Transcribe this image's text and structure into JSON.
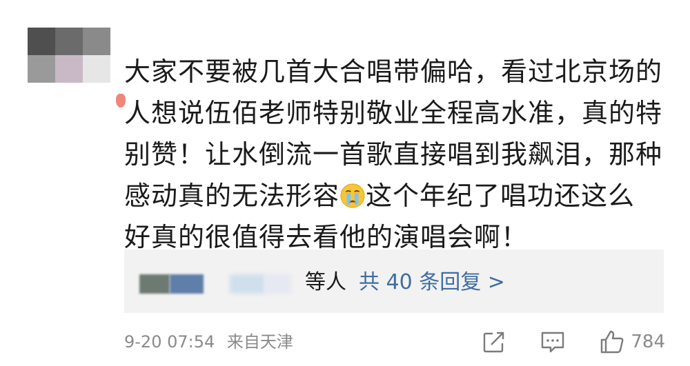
{
  "comment": {
    "username": "",
    "lines": [
      "大家不要被几首大合唱带偏哈，看过北京场的",
      "人想说伍佰老师特别敬业全程高水准，真的特",
      "别赞！让水倒流一首歌直接唱到我飙泪，那种",
      "感动真的无法形容",
      "这个年纪了唱功还这么",
      "好真的很值得去看他的演唱会啊！"
    ],
    "emoji": "crying-face"
  },
  "replies": {
    "others_label": "等人",
    "count_label": "共 40 条回复 >"
  },
  "footer": {
    "date": "9-20 07:54",
    "source": "来自天津",
    "like_count": "784"
  },
  "colors": {
    "text": "#1a1a1a",
    "muted": "#8a8a8a",
    "link": "#3f6ca3",
    "reply_bg": "#f2f2f2"
  }
}
